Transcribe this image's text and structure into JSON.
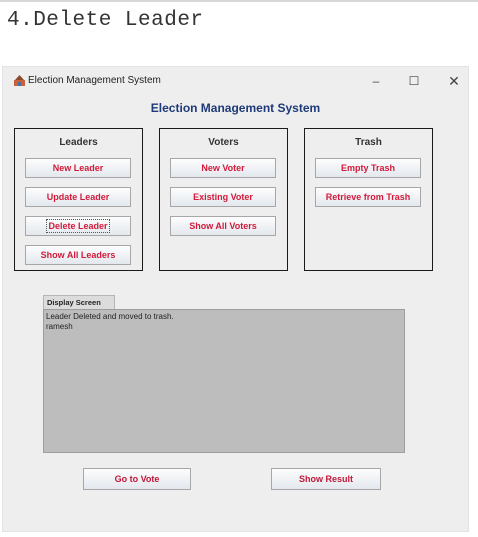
{
  "page": {
    "heading": "4.Delete Leader"
  },
  "window": {
    "title": "Election Management System",
    "controls": {
      "minimize": "–",
      "maximize": "☐",
      "close": "✕"
    }
  },
  "app": {
    "title": "Election Management System"
  },
  "panels": {
    "leaders": {
      "title": "Leaders",
      "buttons": [
        "New Leader",
        "Update Leader",
        "Delete Leader",
        "Show All Leaders"
      ]
    },
    "voters": {
      "title": "Voters",
      "buttons": [
        "New Voter",
        "Existing Voter",
        "Show All Voters"
      ]
    },
    "trash": {
      "title": "Trash",
      "buttons": [
        "Empty Trash",
        "Retrieve from Trash"
      ]
    }
  },
  "display": {
    "tab_label": "Display Screen",
    "lines": [
      "Leader Deleted and moved to trash.",
      "ramesh"
    ]
  },
  "footer": {
    "vote_label": "Go to Vote",
    "result_label": "Show Result"
  },
  "colors": {
    "button_text": "#d21a3b",
    "app_title": "#1e3a78",
    "display_bg": "#bdbdbd"
  }
}
